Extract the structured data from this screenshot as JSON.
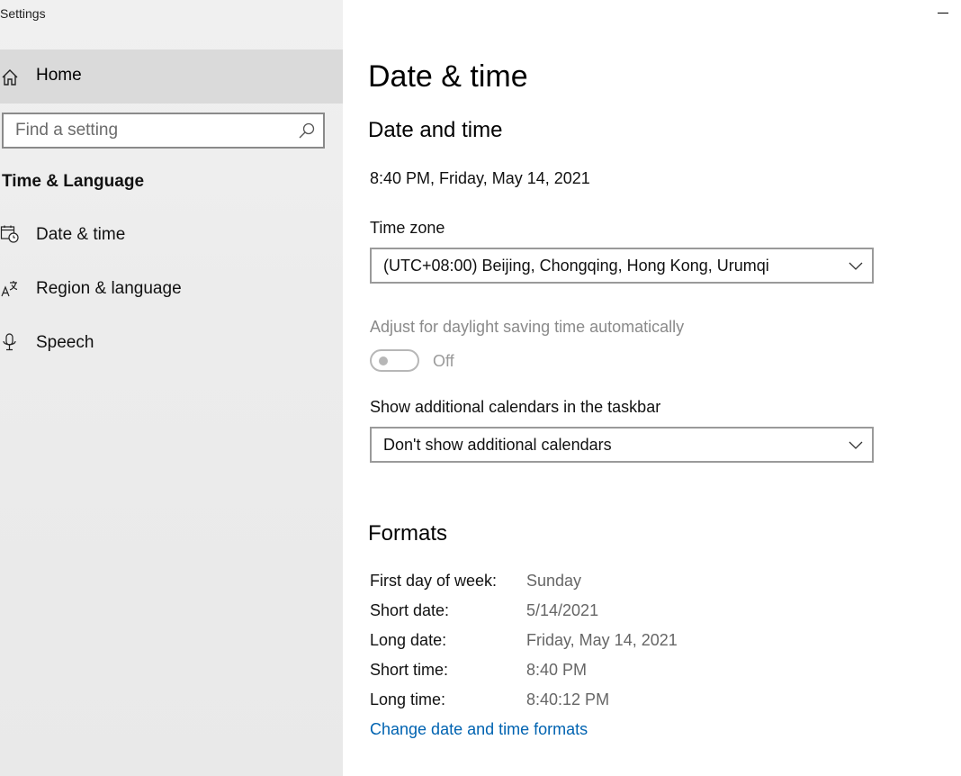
{
  "window": {
    "title": "Settings"
  },
  "sidebar": {
    "home_label": "Home",
    "search_placeholder": "Find a setting",
    "section_title": "Time & Language",
    "items": [
      {
        "label": "Date & time",
        "icon": "calendar-clock-icon"
      },
      {
        "label": "Region & language",
        "icon": "language-icon"
      },
      {
        "label": "Speech",
        "icon": "microphone-icon"
      }
    ]
  },
  "main": {
    "page_title": "Date & time",
    "date_time": {
      "heading": "Date and time",
      "current": "8:40 PM, Friday, May 14, 2021",
      "timezone_label": "Time zone",
      "timezone_value": "(UTC+08:00) Beijing, Chongqing, Hong Kong, Urumqi",
      "dst_label": "Adjust for daylight saving time automatically",
      "dst_state": "Off",
      "calendars_label": "Show additional calendars in the taskbar",
      "calendars_value": "Don't show additional calendars"
    },
    "formats": {
      "heading": "Formats",
      "rows": [
        {
          "label": "First day of week:",
          "value": "Sunday"
        },
        {
          "label": "Short date:",
          "value": "5/14/2021"
        },
        {
          "label": "Long date:",
          "value": "Friday, May 14, 2021"
        },
        {
          "label": "Short time:",
          "value": "8:40 PM"
        },
        {
          "label": "Long time:",
          "value": "8:40:12 PM"
        }
      ],
      "change_link": "Change date and time formats"
    }
  },
  "colors": {
    "accent": "#0063b1",
    "sidebar_bg": "#ececec",
    "selected_bg": "#dadada"
  }
}
